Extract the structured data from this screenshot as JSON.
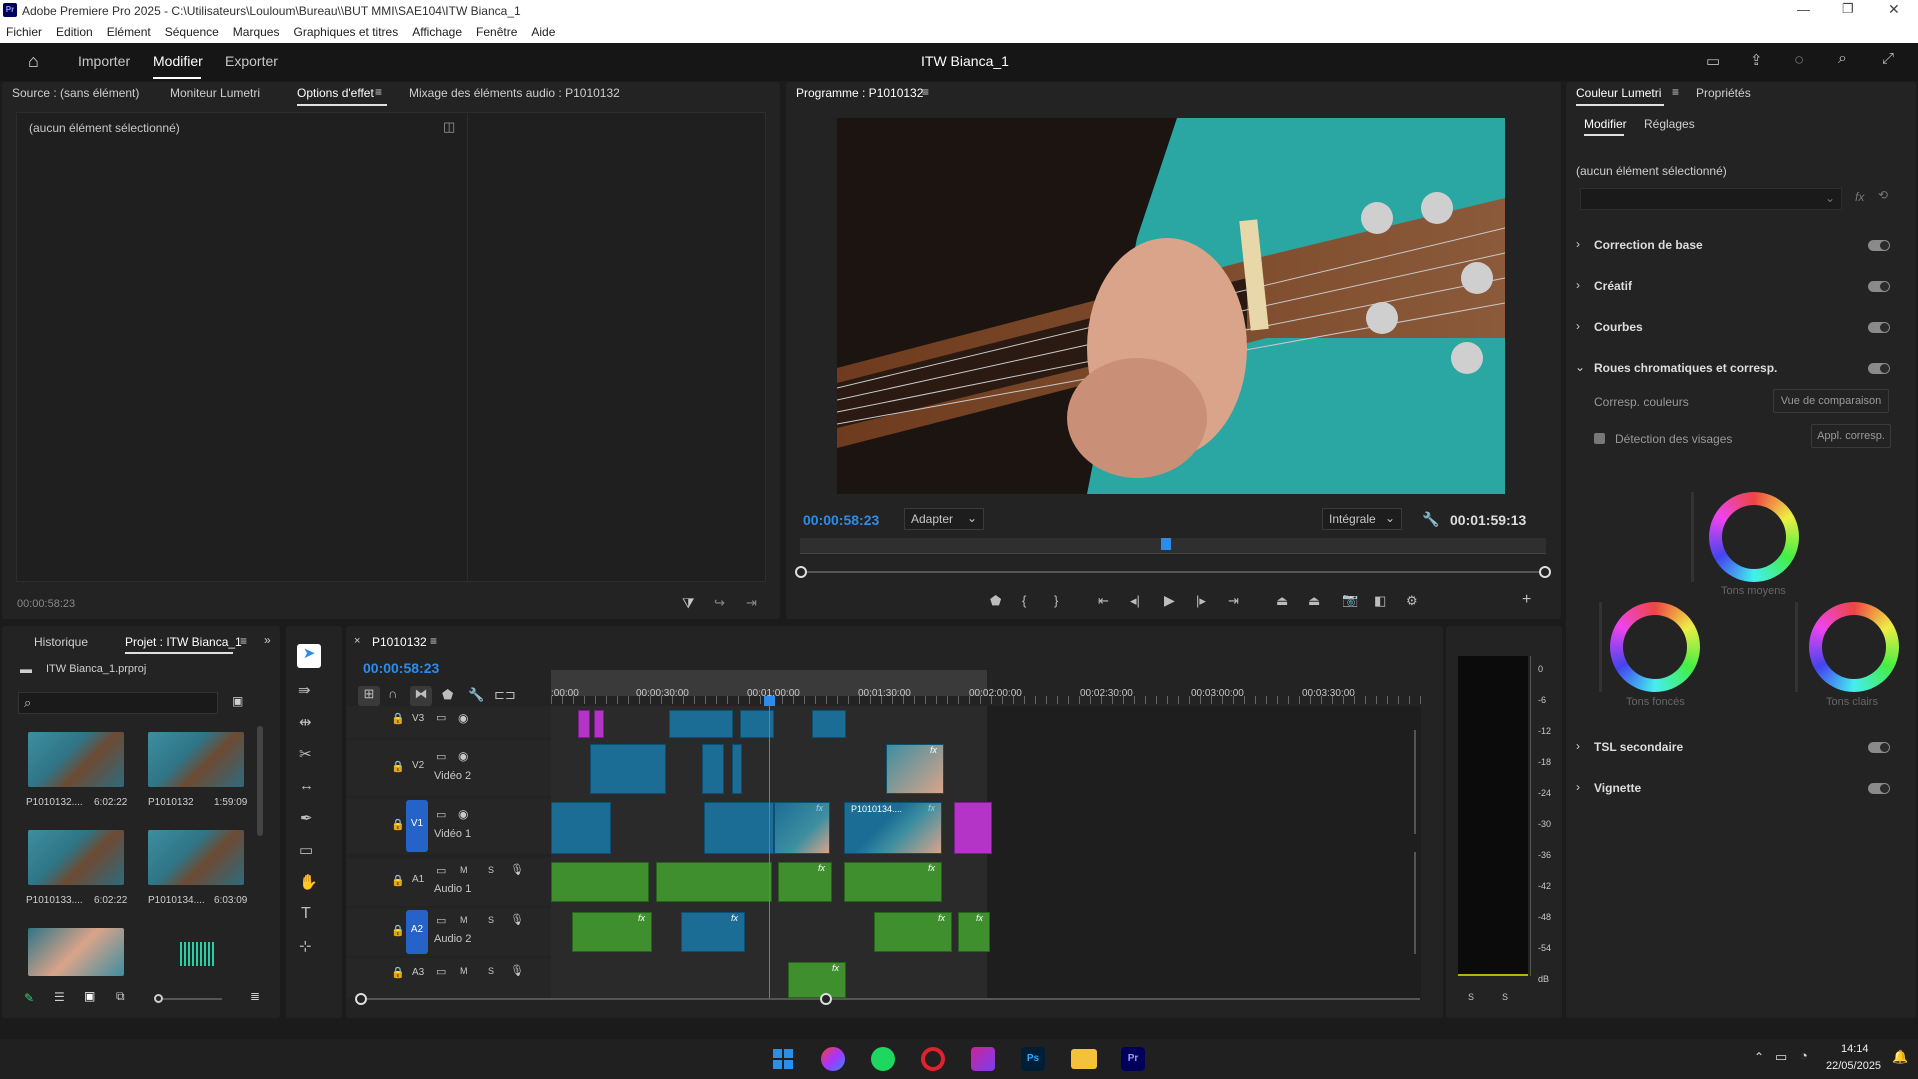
{
  "window": {
    "title": "Adobe Premiere Pro 2025 - C:\\Utilisateurs\\Louloum\\Bureau\\\\BUT MMI\\SAE104\\ITW Bianca_1",
    "app_icon": "Pr"
  },
  "menu": [
    "Fichier",
    "Edition",
    "Elément",
    "Séquence",
    "Marques",
    "Graphiques et titres",
    "Affichage",
    "Fenêtre",
    "Aide"
  ],
  "nav": {
    "import": "Importer",
    "edit": "Modifier",
    "export": "Exporter",
    "project_title": "ITW Bianca_1"
  },
  "source_panel": {
    "tabs": [
      "Source : (sans élément)",
      "Moniteur Lumetri",
      "Options d'effet",
      "Mixage des éléments audio : P1010132"
    ],
    "active_tab": "Options d'effet",
    "empty_label": "(aucun élément sélectionné)",
    "timecode": "00:00:58:23"
  },
  "program": {
    "title": "Programme : P1010132",
    "timecode": "00:00:58:23",
    "fit": "Adapter",
    "quality": "Intégrale",
    "duration": "00:01:59:13",
    "playhead_fraction": 0.49
  },
  "lumetri": {
    "tabs": [
      "Couleur Lumetri",
      "Propriétés"
    ],
    "subtabs": [
      "Modifier",
      "Réglages"
    ],
    "empty_label": "(aucun élément sélectionné)",
    "fx_label": "fx",
    "sections": [
      "Correction de base",
      "Créatif",
      "Courbes",
      "Roues chromatiques et corresp.",
      "TSL secondaire",
      "Vignette"
    ],
    "match_label": "Corresp. couleurs",
    "compare_button": "Vue de comparaison",
    "face_detect": "Détection des visages",
    "apply_button": "Appl. corresp.",
    "wheels": {
      "mid": "Tons moyens",
      "shadows": "Tons foncés",
      "highlights": "Tons clairs"
    }
  },
  "project": {
    "tabs": [
      "Historique",
      "Projet : ITW Bianca_1"
    ],
    "file": "ITW Bianca_1.prproj",
    "search_placeholder": "",
    "items": [
      {
        "name": "P1010132....",
        "dur": "6:02:22"
      },
      {
        "name": "P1010132",
        "dur": "1:59:09"
      },
      {
        "name": "P1010133....",
        "dur": "6:02:22"
      },
      {
        "name": "P1010134....",
        "dur": "6:03:09"
      }
    ]
  },
  "timeline": {
    "tab": "P1010132",
    "timecode": "00:00:58:23",
    "ruler": [
      ":00:00",
      "00:00:30:00",
      "00:01:00:00",
      "00:01:30:00",
      "00:02:00:00",
      "00:02:30:00",
      "00:03:00:00",
      "00:03:30:00"
    ],
    "tracks": [
      {
        "id": "V3",
        "name": ""
      },
      {
        "id": "V2",
        "name": "Vidéo 2"
      },
      {
        "id": "V1",
        "name": "Vidéo 1"
      },
      {
        "id": "A1",
        "name": "Audio 1"
      },
      {
        "id": "A2",
        "name": "Audio 2"
      },
      {
        "id": "A3",
        "name": ""
      }
    ],
    "clip_label": "P1010134....",
    "fx": "fx",
    "m": "M",
    "s": "S"
  },
  "meter": {
    "scale": [
      "0",
      "-6",
      "-12",
      "-18",
      "-24",
      "-30",
      "-36",
      "-42",
      "-48",
      "-54",
      "dB"
    ],
    "footer": [
      "S",
      "S"
    ]
  },
  "taskbar": {
    "time": "14:14",
    "date": "22/05/2025"
  },
  "colors": {
    "accent": "#2d8ceb",
    "video_clip": "#1b6d96",
    "audio_clip": "#3f8f2f",
    "adjust_clip": "#b534c8"
  }
}
